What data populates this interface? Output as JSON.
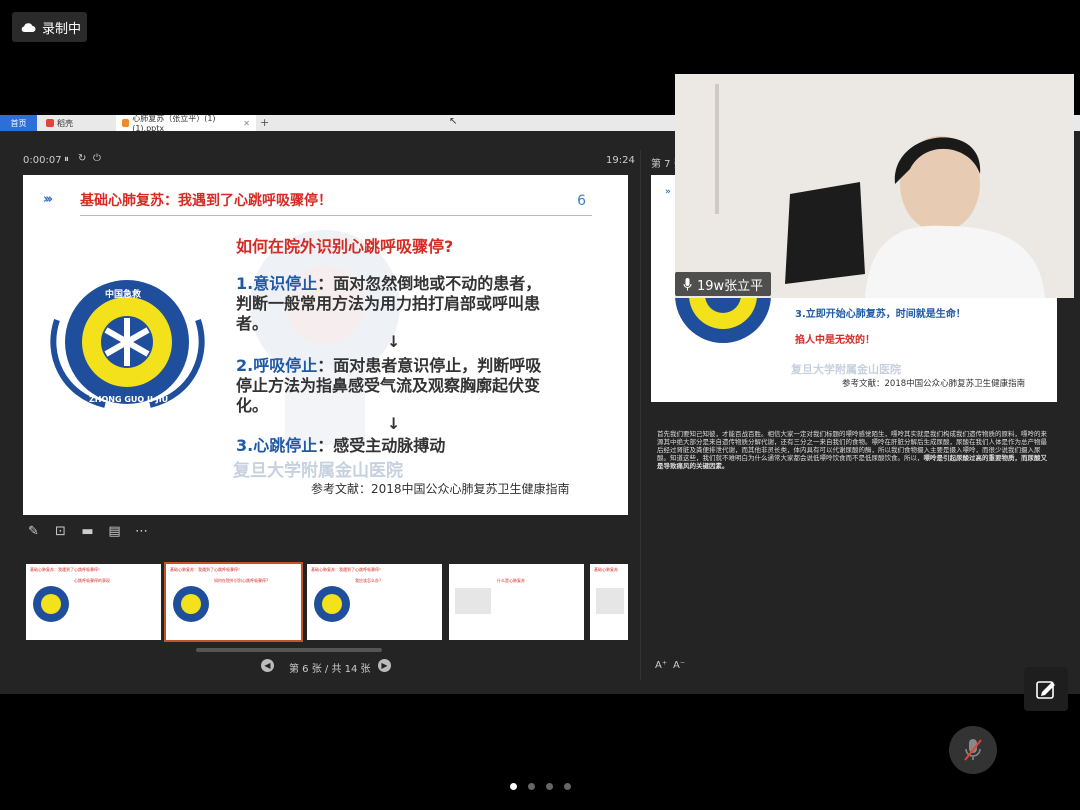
{
  "recording": {
    "label": "录制中",
    "icon": "cloud-icon"
  },
  "browser": {
    "tabs": [
      {
        "label": "首页"
      },
      {
        "label": "稻壳"
      },
      {
        "label": "心肺复苏（张立平）(1)(1).pptx"
      }
    ],
    "new_tab": "+"
  },
  "presenter": {
    "timer": "0:00:07",
    "clock": "19:24",
    "next_slide_label": "第 7 张",
    "page_indicator": "第 6 张 / 共 14 张"
  },
  "slide": {
    "title": "基础心肺复苏：我遇到了心跳呼吸骤停！",
    "number": "6",
    "question": "如何在院外识别心跳呼吸骤停?",
    "item1_heading": "1.意识停止",
    "item1_text": "：面对忽然倒地或不动的患者，判断一般常用方法为用力拍打肩部或呼叫患者。",
    "arrow": "↓",
    "item2_heading": "2.呼吸停止",
    "item2_text": "：面对患者意识停止，判断呼吸停止方法为指鼻感受气流及观察胸廓起伏变化。",
    "item3_heading": "3.心跳停止",
    "item3_text": "：感受主动脉搏动",
    "hospital_watermark": "复旦大学附属金山医院",
    "reference": "参考文献：2018中国公众心肺复苏卫生健康指南",
    "logo_top_text": "中国急救",
    "logo_bottom_text": "ZHONG GUO JI JIU"
  },
  "next_slide": {
    "text1": "3.立即开始心肺复苏，时间就是生命！",
    "text2": "掐人中是无效的！",
    "hospital_watermark": "复旦大学附属金山医院",
    "reference": "参考文献：2018中国公众心肺复苏卫生健康指南"
  },
  "video": {
    "participant_name": "19w张立平"
  },
  "notes": {
    "text_plain": "首先我们要知己知彼，才能百战百胜。相信大家一定对我们标题的嘌呤感觉陌生，嘌呤其实就是我们构成我们遗传物质的原料，嘌呤的来源其中绝大部分是来自遗传物质分解代谢，还有三分之一来自我们的食物。嘌呤在肝脏分解后生成尿酸，尿酸在我们人体是作为总产物最后经过肾脏及粪便排泄代谢，而其他非灵长类，体内具有可以代谢尿酸的酶，所以我们食物摄入主要是摄入嘌呤，而很少说我们摄入尿酸。知道这些，我们就不难明白为什么通常大家都会说低嘌呤饮食而不是低尿酸饮食。所以，",
    "text_bold": "嘌呤是引起尿酸过高的重要物质，而尿酸又是导致痛风的关键因素。"
  },
  "thumbnails": [
    {
      "title": "基础心肺复苏：我遇到了心跳呼吸骤停！",
      "body": "心跳呼吸骤停的表现"
    },
    {
      "title": "基础心肺复苏：我遇到了心跳呼吸骤停！",
      "body": "如何在院外识别心跳呼吸骤停?"
    },
    {
      "title": "基础心肺复苏：我遇到了心跳呼吸骤停！",
      "body": "我应该怎么办?"
    },
    {
      "title": "",
      "body": "什么是心肺复苏"
    },
    {
      "title": "基础心肺复苏",
      "body": ""
    }
  ],
  "font_controls": {
    "increase": "A⁺",
    "decrease": "A⁻"
  },
  "pagination_dots": 4,
  "colors": {
    "accent_red": "#d42b25",
    "accent_blue": "#1f5aa6",
    "bg_dark": "#242424"
  }
}
